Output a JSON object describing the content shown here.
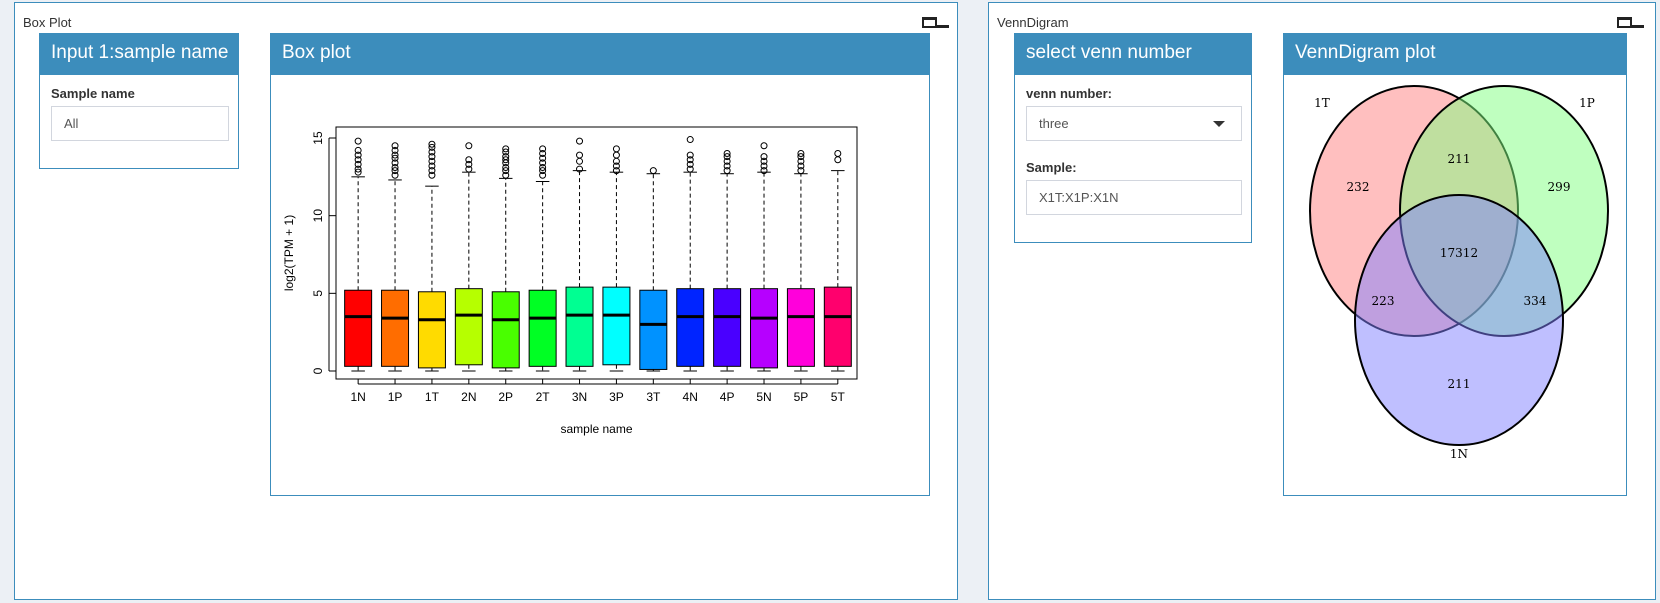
{
  "left_section": {
    "title": "Box Plot",
    "input_panel": {
      "header": "Input 1:sample name",
      "sample_label": "Sample name",
      "sample_value": "All"
    },
    "box_panel": {
      "header": "Box plot"
    }
  },
  "right_section": {
    "title": "VennDigram",
    "select_panel": {
      "header": "select venn number",
      "venn_label": "venn number:",
      "venn_value": "three",
      "sample_label": "Sample:",
      "sample_value": "X1T:X1P:X1N"
    },
    "venn_panel": {
      "header": "VennDigram plot",
      "set_labels": [
        "1T",
        "1P",
        "1N"
      ],
      "counts": {
        "t_only": "232",
        "p_only": "299",
        "n_only": "211",
        "tp": "211",
        "tn": "223",
        "pn": "334",
        "tpn": "17312"
      },
      "colors": [
        "#ff8080",
        "#80ff80",
        "#8080ff"
      ]
    }
  },
  "chart_data": {
    "type": "box",
    "xlabel": "sample name",
    "ylabel": "log2(TPM + 1)",
    "ylim": [
      0,
      15
    ],
    "yticks": [
      0,
      5,
      10,
      15
    ],
    "grid": false,
    "categories": [
      "1N",
      "1P",
      "1T",
      "2N",
      "2P",
      "2T",
      "3N",
      "3P",
      "3T",
      "4N",
      "4P",
      "5N",
      "5P",
      "5T"
    ],
    "colors": [
      "#ff0000",
      "#ff6d00",
      "#ffdb00",
      "#b6ff00",
      "#49ff00",
      "#00ff24",
      "#00ff92",
      "#00ffff",
      "#0092ff",
      "#0024ff",
      "#4900ff",
      "#b600ff",
      "#ff00db",
      "#ff006d"
    ],
    "boxes": [
      {
        "min": 0.0,
        "q1": 0.3,
        "median": 3.5,
        "q3": 5.2,
        "whisker_high": 12.5,
        "outliers": [
          12.8,
          13.0,
          13.3,
          13.6,
          13.9,
          14.2,
          14.8
        ]
      },
      {
        "min": 0.0,
        "q1": 0.3,
        "median": 3.4,
        "q3": 5.2,
        "whisker_high": 12.3,
        "outliers": [
          12.6,
          12.9,
          13.1,
          13.4,
          13.7,
          13.9,
          14.2,
          14.5
        ]
      },
      {
        "min": 0.0,
        "q1": 0.2,
        "median": 3.3,
        "q3": 5.1,
        "whisker_high": 11.9,
        "outliers": [
          12.6,
          12.9,
          13.2,
          13.5,
          13.8,
          14.1,
          14.4,
          14.6
        ]
      },
      {
        "min": 0.0,
        "q1": 0.4,
        "median": 3.6,
        "q3": 5.3,
        "whisker_high": 12.8,
        "outliers": [
          13.0,
          13.3,
          13.6,
          14.5
        ]
      },
      {
        "min": 0.0,
        "q1": 0.2,
        "median": 3.3,
        "q3": 5.1,
        "whisker_high": 12.4,
        "outliers": [
          12.6,
          12.9,
          13.1,
          13.4,
          13.6,
          13.8,
          14.1,
          14.3
        ]
      },
      {
        "min": 0.0,
        "q1": 0.3,
        "median": 3.4,
        "q3": 5.2,
        "whisker_high": 12.2,
        "outliers": [
          12.6,
          12.9,
          13.1,
          13.4,
          13.7,
          14.0,
          14.3
        ]
      },
      {
        "min": 0.0,
        "q1": 0.3,
        "median": 3.6,
        "q3": 5.4,
        "whisker_high": 12.9,
        "outliers": [
          13.0,
          13.5,
          13.9,
          14.8
        ]
      },
      {
        "min": 0.0,
        "q1": 0.4,
        "median": 3.6,
        "q3": 5.4,
        "whisker_high": 12.8,
        "outliers": [
          12.9,
          13.2,
          13.5,
          13.9,
          14.3
        ]
      },
      {
        "min": 0.0,
        "q1": 0.1,
        "median": 3.0,
        "q3": 5.2,
        "whisker_high": 12.7,
        "outliers": [
          12.9
        ]
      },
      {
        "min": 0.0,
        "q1": 0.3,
        "median": 3.5,
        "q3": 5.3,
        "whisker_high": 12.8,
        "outliers": [
          13.0,
          13.3,
          13.6,
          13.9,
          14.9
        ]
      },
      {
        "min": 0.0,
        "q1": 0.3,
        "median": 3.5,
        "q3": 5.3,
        "whisker_high": 12.7,
        "outliers": [
          12.9,
          13.2,
          13.5,
          13.8,
          14.0
        ]
      },
      {
        "min": 0.0,
        "q1": 0.2,
        "median": 3.4,
        "q3": 5.3,
        "whisker_high": 12.8,
        "outliers": [
          12.9,
          13.2,
          13.5,
          13.8,
          14.5
        ]
      },
      {
        "min": 0.0,
        "q1": 0.3,
        "median": 3.5,
        "q3": 5.3,
        "whisker_high": 12.7,
        "outliers": [
          12.9,
          13.2,
          13.5,
          13.8,
          14.0
        ]
      },
      {
        "min": 0.0,
        "q1": 0.3,
        "median": 3.5,
        "q3": 5.4,
        "whisker_high": 12.9,
        "outliers": [
          13.6,
          14.0
        ]
      }
    ]
  }
}
